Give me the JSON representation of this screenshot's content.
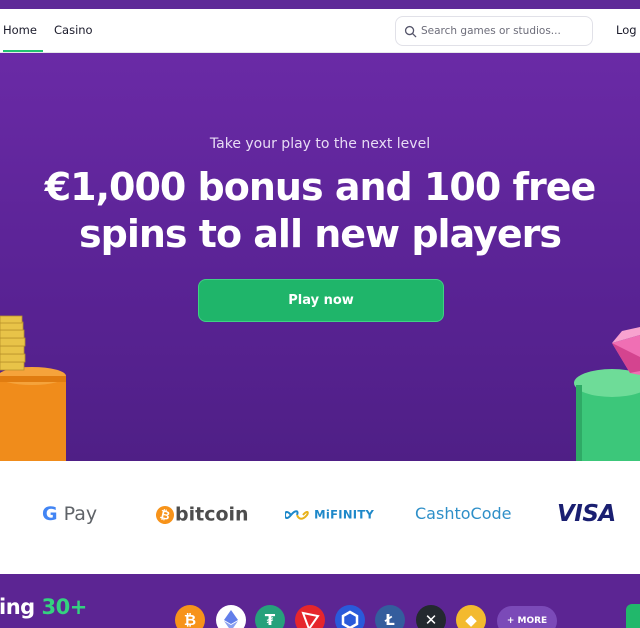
{
  "header": {
    "nav": [
      {
        "label": "Home",
        "active": true
      },
      {
        "label": "Casino",
        "active": false
      }
    ],
    "search_placeholder": "Search games or studios...",
    "login_label": "Log i"
  },
  "hero": {
    "subtitle": "Take your play to the next level",
    "title": "€1,000 bonus and 100 free spins to all new players",
    "cta_label": "Play now"
  },
  "payments": {
    "gpay_g": "G",
    "gpay_pay": "Pay",
    "bitcoin_symbol": "₿",
    "bitcoin": "bitcoin",
    "mifinity": "MiFINITY",
    "cashtocode": "CashtoCode",
    "visa": "VISA"
  },
  "crypto_band": {
    "text_start": "ing ",
    "text_accent": "30+",
    "more_label": "+ MORE",
    "icons": [
      "bitcoin-icon",
      "ethereum-icon",
      "tether-icon",
      "tron-icon",
      "chainlink-icon",
      "litecoin-icon",
      "xrp-icon",
      "bnb-icon"
    ]
  },
  "colors": {
    "brand_purple": "#5f2a98",
    "accent_green": "#22c271",
    "cta_green": "#1fb56a"
  }
}
